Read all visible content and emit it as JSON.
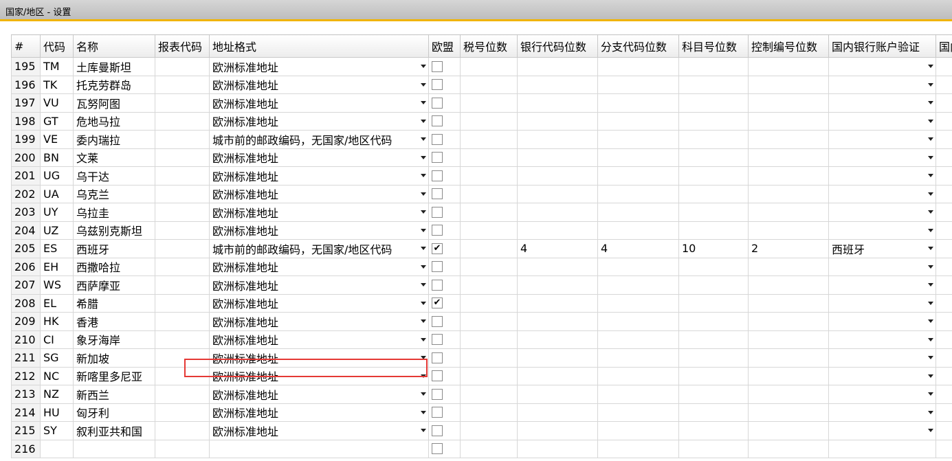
{
  "window": {
    "title": "国家/地区 - 设置"
  },
  "columns": [
    "#",
    "代码",
    "名称",
    "报表代码",
    "地址格式",
    "欧盟",
    "税号位数",
    "银行代码位数",
    "分支代码位数",
    "科目号位数",
    "控制编号位数",
    "国内银行账户验证",
    "国内"
  ],
  "rows": [
    {
      "num": "195",
      "code": "TM",
      "name": "土库曼斯坦",
      "report": "",
      "format": "欧洲标准地址",
      "eu": "",
      "tax": "",
      "bank": "",
      "branch": "",
      "account": "",
      "control": "",
      "domestic": ""
    },
    {
      "num": "196",
      "code": "TK",
      "name": "托克劳群岛",
      "report": "",
      "format": "欧洲标准地址",
      "eu": "",
      "tax": "",
      "bank": "",
      "branch": "",
      "account": "",
      "control": "",
      "domestic": ""
    },
    {
      "num": "197",
      "code": "VU",
      "name": "瓦努阿图",
      "report": "",
      "format": "欧洲标准地址",
      "eu": "",
      "tax": "",
      "bank": "",
      "branch": "",
      "account": "",
      "control": "",
      "domestic": ""
    },
    {
      "num": "198",
      "code": "GT",
      "name": "危地马拉",
      "report": "",
      "format": "欧洲标准地址",
      "eu": "",
      "tax": "",
      "bank": "",
      "branch": "",
      "account": "",
      "control": "",
      "domestic": ""
    },
    {
      "num": "199",
      "code": "VE",
      "name": "委内瑞拉",
      "report": "",
      "format": "城市前的邮政编码，无国家/地区代码",
      "eu": "",
      "tax": "",
      "bank": "",
      "branch": "",
      "account": "",
      "control": "",
      "domestic": ""
    },
    {
      "num": "200",
      "code": "BN",
      "name": "文莱",
      "report": "",
      "format": "欧洲标准地址",
      "eu": "",
      "tax": "",
      "bank": "",
      "branch": "",
      "account": "",
      "control": "",
      "domestic": ""
    },
    {
      "num": "201",
      "code": "UG",
      "name": "乌干达",
      "report": "",
      "format": "欧洲标准地址",
      "eu": "",
      "tax": "",
      "bank": "",
      "branch": "",
      "account": "",
      "control": "",
      "domestic": ""
    },
    {
      "num": "202",
      "code": "UA",
      "name": "乌克兰",
      "report": "",
      "format": "欧洲标准地址",
      "eu": "",
      "tax": "",
      "bank": "",
      "branch": "",
      "account": "",
      "control": "",
      "domestic": ""
    },
    {
      "num": "203",
      "code": "UY",
      "name": "乌拉圭",
      "report": "",
      "format": "欧洲标准地址",
      "eu": "",
      "tax": "",
      "bank": "",
      "branch": "",
      "account": "",
      "control": "",
      "domestic": ""
    },
    {
      "num": "204",
      "code": "UZ",
      "name": "乌兹别克斯坦",
      "report": "",
      "format": "欧洲标准地址",
      "eu": "",
      "tax": "",
      "bank": "",
      "branch": "",
      "account": "",
      "control": "",
      "domestic": ""
    },
    {
      "num": "205",
      "code": "ES",
      "name": "西班牙",
      "report": "",
      "format": "城市前的邮政编码，无国家/地区代码",
      "eu": "✔",
      "tax": "",
      "bank": "4",
      "branch": "4",
      "account": "10",
      "control": "2",
      "domestic": "西班牙"
    },
    {
      "num": "206",
      "code": "EH",
      "name": "西撒哈拉",
      "report": "",
      "format": "欧洲标准地址",
      "eu": "",
      "tax": "",
      "bank": "",
      "branch": "",
      "account": "",
      "control": "",
      "domestic": ""
    },
    {
      "num": "207",
      "code": "WS",
      "name": "西萨摩亚",
      "report": "",
      "format": "欧洲标准地址",
      "eu": "",
      "tax": "",
      "bank": "",
      "branch": "",
      "account": "",
      "control": "",
      "domestic": ""
    },
    {
      "num": "208",
      "code": "EL",
      "name": "希腊",
      "report": "",
      "format": "欧洲标准地址",
      "eu": "✔",
      "tax": "",
      "bank": "",
      "branch": "",
      "account": "",
      "control": "",
      "domestic": ""
    },
    {
      "num": "209",
      "code": "HK",
      "name": "香港",
      "report": "",
      "format": "欧洲标准地址",
      "eu": "",
      "tax": "",
      "bank": "",
      "branch": "",
      "account": "",
      "control": "",
      "domestic": ""
    },
    {
      "num": "210",
      "code": "CI",
      "name": "象牙海岸",
      "report": "",
      "format": "欧洲标准地址",
      "eu": "",
      "tax": "",
      "bank": "",
      "branch": "",
      "account": "",
      "control": "",
      "domestic": ""
    },
    {
      "num": "211",
      "code": "SG",
      "name": "新加坡",
      "report": "",
      "format": "欧洲标准地址",
      "eu": "",
      "tax": "",
      "bank": "",
      "branch": "",
      "account": "",
      "control": "",
      "domestic": ""
    },
    {
      "num": "212",
      "code": "NC",
      "name": "新喀里多尼亚",
      "report": "",
      "format": "欧洲标准地址",
      "eu": "",
      "tax": "",
      "bank": "",
      "branch": "",
      "account": "",
      "control": "",
      "domestic": ""
    },
    {
      "num": "213",
      "code": "NZ",
      "name": "新西兰",
      "report": "",
      "format": "欧洲标准地址",
      "eu": "",
      "tax": "",
      "bank": "",
      "branch": "",
      "account": "",
      "control": "",
      "domestic": ""
    },
    {
      "num": "214",
      "code": "HU",
      "name": "匈牙利",
      "report": "",
      "format": "欧洲标准地址",
      "eu": "",
      "tax": "",
      "bank": "",
      "branch": "",
      "account": "",
      "control": "",
      "domestic": ""
    },
    {
      "num": "215",
      "code": "SY",
      "name": "叙利亚共和国",
      "report": "",
      "format": "欧洲标准地址",
      "eu": "",
      "tax": "",
      "bank": "",
      "branch": "",
      "account": "",
      "control": "",
      "domestic": ""
    },
    {
      "num": "216",
      "code": "",
      "name": "",
      "report": "",
      "format": "",
      "eu": "",
      "tax": "",
      "bank": "",
      "branch": "",
      "account": "",
      "control": "",
      "domestic": ""
    }
  ],
  "icons": {
    "dropdown": "dropdown-arrow-icon",
    "checkbox": "checkbox-icon"
  },
  "colors": {
    "accent": "#f0b400",
    "highlight": "#e53935",
    "grid_line": "#d7d7d7"
  }
}
